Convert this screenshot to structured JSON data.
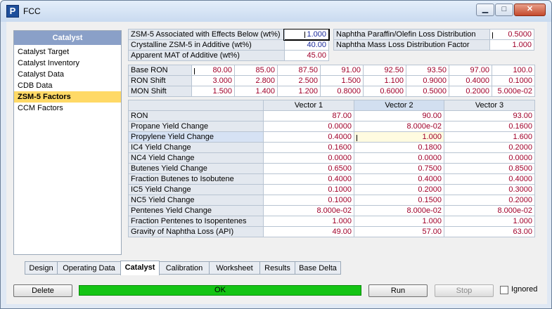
{
  "window": {
    "title": "FCC",
    "app_icon": "P",
    "minimize": "▁",
    "maximize": "□",
    "close": "✕"
  },
  "sidebar": {
    "header": "Catalyst",
    "items": [
      "Catalyst Target",
      "Catalyst Inventory",
      "Catalyst Data",
      "CDB Data",
      "ZSM-5 Factors",
      "CCM Factors"
    ],
    "selected_index": 4
  },
  "additive": {
    "rows": [
      {
        "label": "ZSM-5 Associated with Effects Below (wt%)",
        "value": "1.000"
      },
      {
        "label": "Crystalline ZSM-5 in Additive (wt%)",
        "value": "40.00"
      },
      {
        "label": "Apparent MAT of Additive (wt%)",
        "value": "45.00"
      }
    ]
  },
  "naphtha": {
    "rows": [
      {
        "label": "Naphtha Paraffin/Olefin Loss Distribution",
        "value": "0.5000"
      },
      {
        "label": "Naphtha Mass Loss Distribution Factor",
        "value": "1.000"
      }
    ]
  },
  "ron_table": {
    "rows": [
      {
        "label": "Base RON",
        "values": [
          "80.00",
          "85.00",
          "87.50",
          "91.00",
          "92.50",
          "93.50",
          "97.00",
          "100.0"
        ]
      },
      {
        "label": "RON Shift",
        "values": [
          "3.000",
          "2.800",
          "2.500",
          "1.500",
          "1.100",
          "0.9000",
          "0.4000",
          "0.1000"
        ]
      },
      {
        "label": "MON Shift",
        "values": [
          "1.500",
          "1.400",
          "1.200",
          "0.8000",
          "0.6000",
          "0.5000",
          "0.2000",
          "5.000e-02"
        ]
      }
    ]
  },
  "vector_table": {
    "headers": [
      "Vector 1",
      "Vector 2",
      "Vector 3"
    ],
    "rows": [
      {
        "label": "RON",
        "values": [
          "87.00",
          "90.00",
          "93.00"
        ]
      },
      {
        "label": "Propane Yield Change",
        "values": [
          "0.0000",
          "8.000e-02",
          "0.1600"
        ]
      },
      {
        "label": "Propylene Yield Change",
        "values": [
          "0.4000",
          "1.000",
          "1.600"
        ]
      },
      {
        "label": "IC4 Yield Change",
        "values": [
          "0.1600",
          "0.1800",
          "0.2000"
        ]
      },
      {
        "label": "NC4 Yield Change",
        "values": [
          "0.0000",
          "0.0000",
          "0.0000"
        ]
      },
      {
        "label": "Butenes Yield Change",
        "values": [
          "0.6500",
          "0.7500",
          "0.8500"
        ]
      },
      {
        "label": "Fraction Butenes to Isobutene",
        "values": [
          "0.4000",
          "0.4000",
          "0.4000"
        ]
      },
      {
        "label": "IC5 Yield Change",
        "values": [
          "0.1000",
          "0.2000",
          "0.3000"
        ]
      },
      {
        "label": "NC5 Yield Change",
        "values": [
          "0.1000",
          "0.1500",
          "0.2000"
        ]
      },
      {
        "label": "Pentenes Yield Change",
        "values": [
          "8.000e-02",
          "8.000e-02",
          "8.000e-02"
        ]
      },
      {
        "label": "Fraction Pentenes to Isopentenes",
        "values": [
          "1.000",
          "1.000",
          "1.000"
        ]
      },
      {
        "label": "Gravity of Naphtha Loss (API)",
        "values": [
          "49.00",
          "57.00",
          "63.00"
        ]
      }
    ]
  },
  "tabs": [
    "Design",
    "Operating Data",
    "Catalyst",
    "Calibration",
    "Worksheet",
    "Results",
    "Base Delta"
  ],
  "active_tab": "Catalyst",
  "bottom": {
    "delete_label": "Delete",
    "status_text": "OK",
    "status_color": "#14c414",
    "run_label": "Run",
    "stop_label": "Stop",
    "ignored_label": "Ignored"
  }
}
